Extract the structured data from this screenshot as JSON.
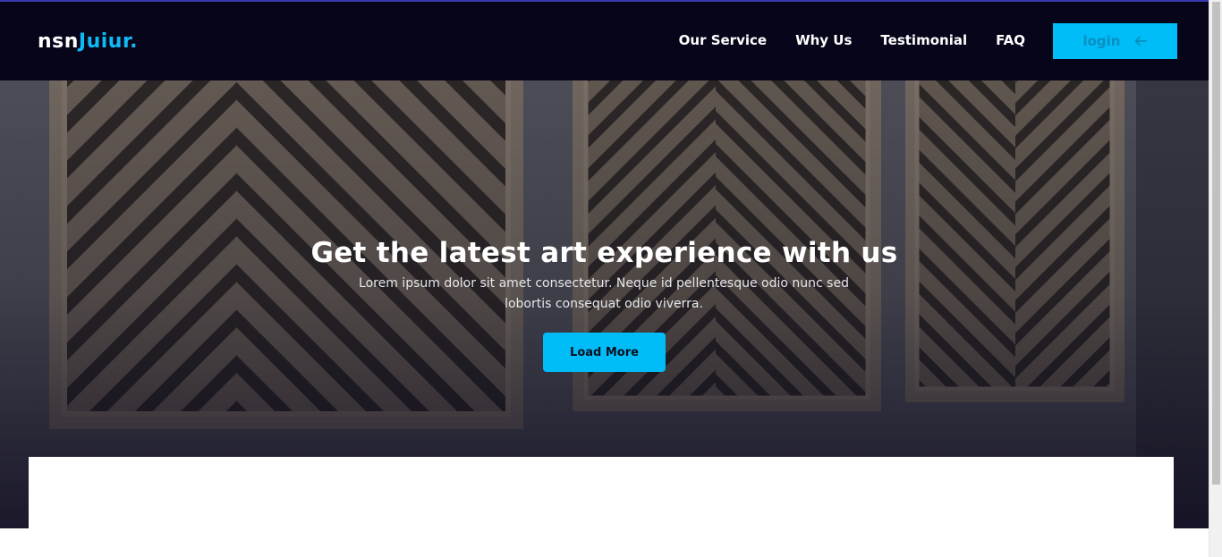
{
  "brand": {
    "logo_main": "nsn",
    "logo_accent": "Juiur.",
    "accent_color": "#00bcf7",
    "nav_bg": "#07051a"
  },
  "nav": {
    "items": [
      {
        "label": "Our Service"
      },
      {
        "label": "Why Us"
      },
      {
        "label": "Testimonial"
      },
      {
        "label": "FAQ"
      }
    ],
    "login_label": "login",
    "login_icon": "arrow-left-icon"
  },
  "hero": {
    "title": "Get the latest art experience with us",
    "subtitle": "Lorem ipsum dolor sit amet consectetur. Neque id pellentesque odio nunc sed lobortis consequat odio viverra.",
    "cta_label": "Load More"
  }
}
